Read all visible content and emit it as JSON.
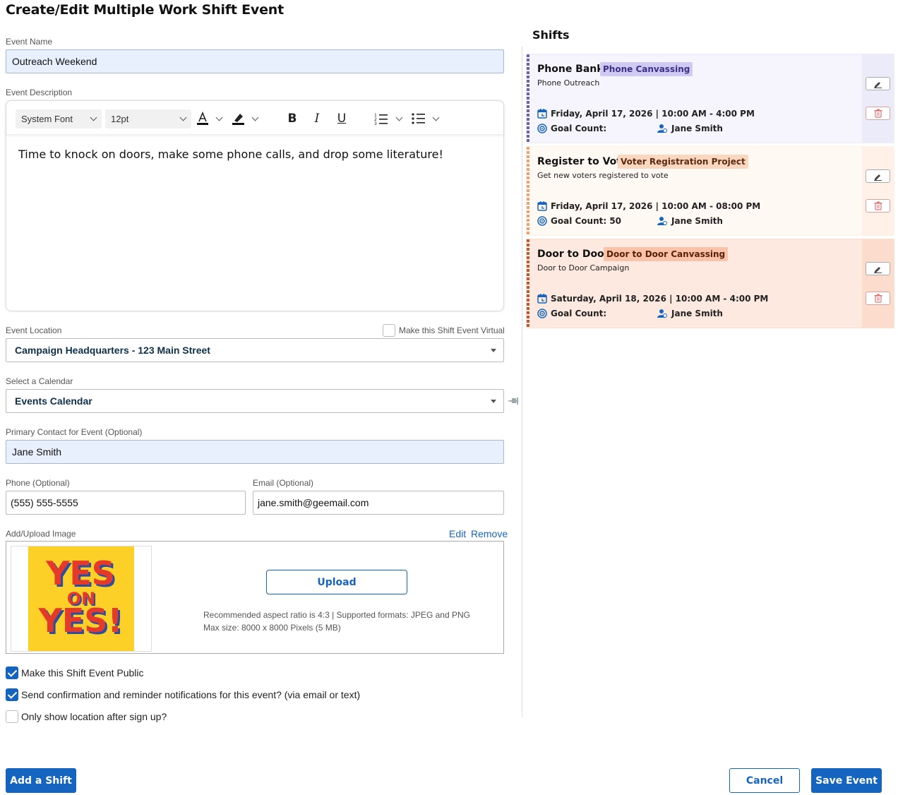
{
  "page": {
    "title": "Create/Edit Multiple Work Shift Event"
  },
  "form": {
    "event_name": {
      "label": "Event Name",
      "value": "Outreach Weekend"
    },
    "event_description": {
      "label": "Event Description",
      "toolbar": {
        "font": "System Font",
        "size": "12pt"
      },
      "text": "Time to knock on doors, make some phone calls, and drop some literature!"
    },
    "event_location": {
      "label": "Event Location",
      "virtual_label": "Make this Shift Event Virtual",
      "virtual_checked": false,
      "value": "Campaign Headquarters - 123 Main Street"
    },
    "calendar": {
      "label": "Select a Calendar",
      "value": "Events Calendar"
    },
    "primary_contact": {
      "label": "Primary Contact for Event (Optional)",
      "value": "Jane Smith"
    },
    "phone": {
      "label": "Phone (Optional)",
      "value": "(555) 555-5555"
    },
    "email": {
      "label": "Email (Optional)",
      "value": "jane.smith@geemail.com"
    },
    "image": {
      "label": "Add/Upload Image",
      "edit_label": "Edit",
      "remove_label": "Remove",
      "upload_label": "Upload",
      "thumbnail_text": [
        "YES",
        "ON",
        "YES!"
      ],
      "helper_line1": "Recommended aspect ratio is 4:3 | Supported formats: JPEG and PNG",
      "helper_line2": "Max size: 8000 x 8000 Pixels (5 MB)"
    },
    "checkboxes": [
      {
        "label": "Make this Shift Event Public",
        "checked": true
      },
      {
        "label": "Send confirmation and reminder notifications for this event? (via email or text)",
        "checked": true
      },
      {
        "label": "Only show location after sign up?",
        "checked": false
      }
    ]
  },
  "shifts": {
    "title": "Shifts",
    "items": [
      {
        "name": "Phone Bank",
        "badge": "Phone Canvassing",
        "description": "Phone Outreach",
        "date": "Friday, April 17, 2026 | 10:00 AM - 4:00 PM",
        "goal": "Goal Count:",
        "person": "Jane Smith",
        "colors": {
          "bg": "#f6f5fd",
          "side": "#ecebf9",
          "stripe": "#6a5fb5",
          "badge_bg": "#cfcaf2",
          "badge_fg": "#3b2f86"
        }
      },
      {
        "name": "Register to Vote",
        "badge": "Voter Registration Project",
        "description": "Get new voters registered to vote",
        "date": "Friday, April 17, 2026 | 10:00 AM - 08:00 PM",
        "goal": "Goal Count: 50",
        "person": "Jane Smith",
        "colors": {
          "bg": "#fff8f3",
          "side": "#fff1e8",
          "stripe": "#f0a070",
          "badge_bg": "#fcd7c0",
          "badge_fg": "#5a2b10"
        }
      },
      {
        "name": "Door to Door",
        "badge": "Door to Door Canvassing",
        "description": "Door to Door Campaign",
        "date": "Saturday, April 18, 2026 | 10:00 AM - 4:00 PM",
        "goal": "Goal Count:",
        "person": "Jane Smith",
        "colors": {
          "bg": "#fde9df",
          "side": "#fcdccd",
          "stripe": "#c8542a",
          "badge_bg": "#f8c3a9",
          "badge_fg": "#5a1f08"
        }
      }
    ]
  },
  "actions": {
    "add_shift": "Add a Shift",
    "cancel": "Cancel",
    "save": "Save Event"
  },
  "theme": {
    "primary": "#1565c0"
  }
}
